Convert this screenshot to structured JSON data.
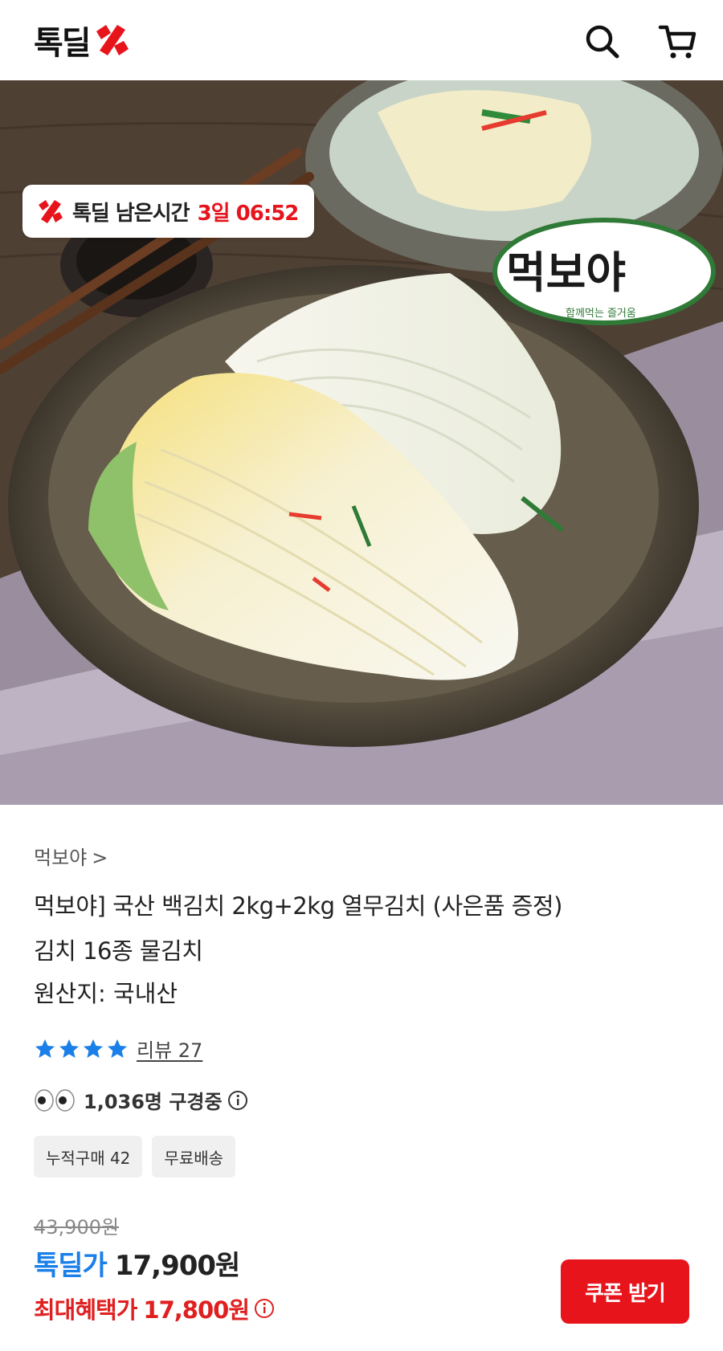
{
  "header": {
    "logo_text": "톡딜",
    "search_icon": "search-icon",
    "cart_icon": "cart-icon"
  },
  "hero": {
    "timer_label": "톡딜 남은시간",
    "timer_value": "3일 06:52",
    "brand_name": "먹보야",
    "brand_slogan": "함께먹는 즐거움",
    "carousel_dot_count": 6,
    "carousel_active_index": 0
  },
  "product": {
    "seller": "먹보야",
    "seller_chevron": ">",
    "title_line1": "먹보야] 국산 백김치 2kg+2kg 열무김치 (사은품 증정)",
    "title_line2": "김치 16종 물김치",
    "origin": "원산지: 국내산",
    "rating_stars": 4,
    "review_text": "리뷰 27",
    "viewers_text": "1,036명 구경중",
    "tags": [
      "누적구매 42",
      "무료배송"
    ]
  },
  "price": {
    "original": "43,900원",
    "deal_label": "톡딜가",
    "deal_value": "17,900원",
    "max_label": "최대혜택가",
    "max_value": "17,800원",
    "coupon_button": "쿠폰 받기"
  },
  "colors": {
    "brand_red": "#e8141c",
    "deal_blue": "#1a7fe8",
    "max_red": "#e02020",
    "star_blue": "#1a7fe8"
  }
}
